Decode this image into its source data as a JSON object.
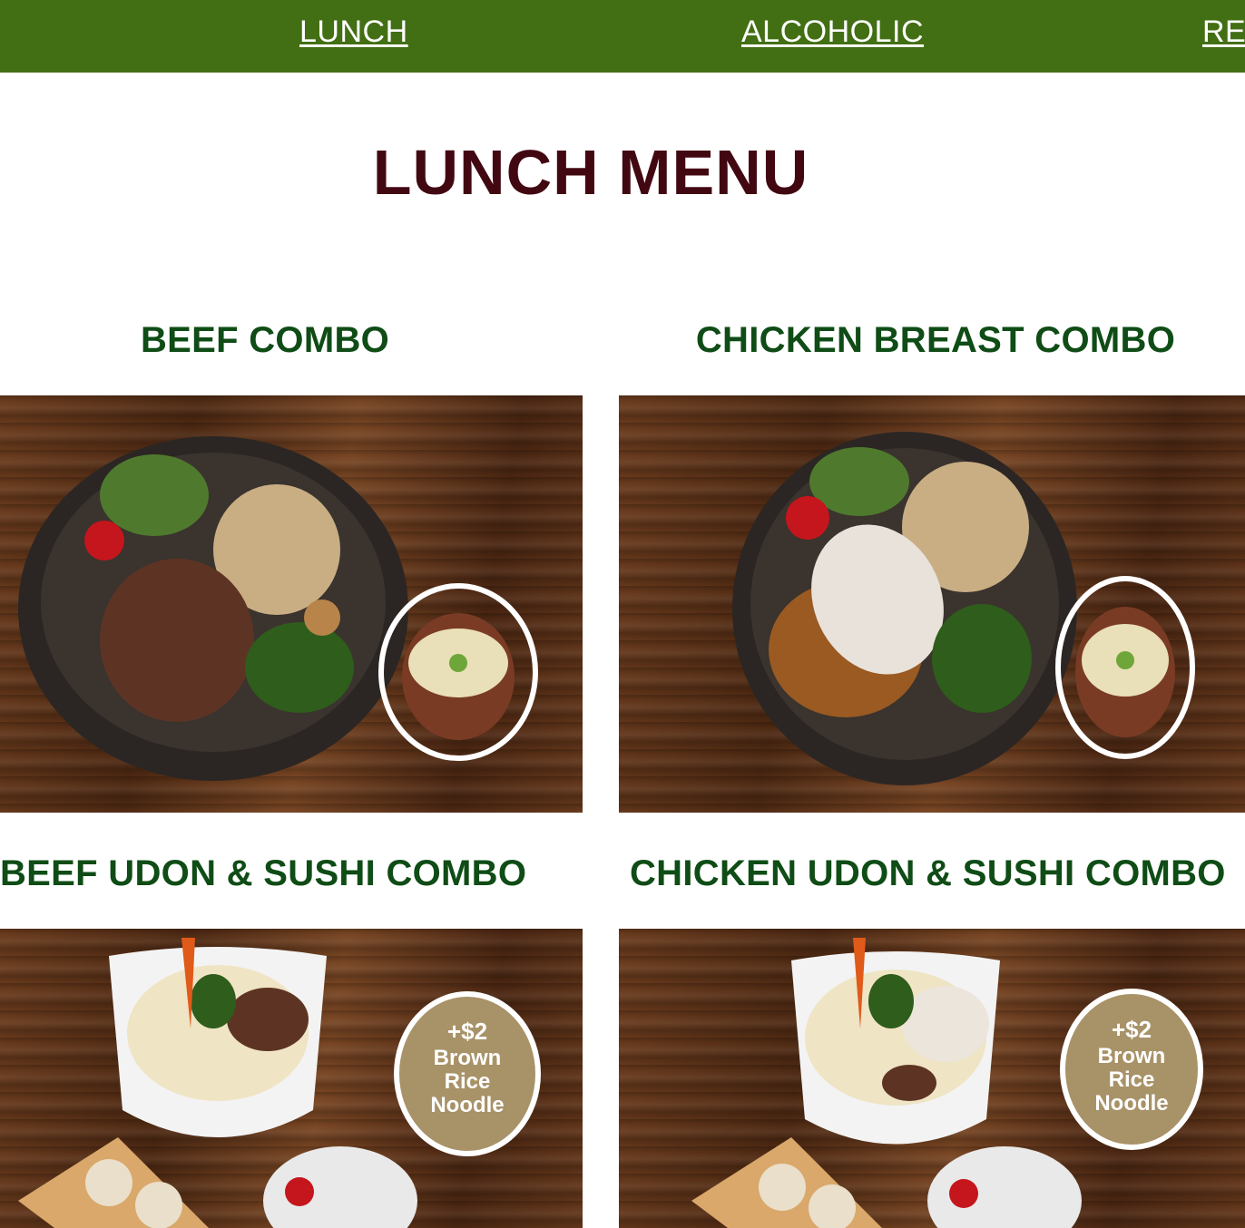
{
  "nav": {
    "lunch": "LUNCH",
    "alcoholic": "ALCOHOLIC",
    "res": "RES"
  },
  "page": {
    "title": "LUNCH MENU"
  },
  "items": [
    {
      "title": "BEEF COMBO"
    },
    {
      "title": "CHICKEN BREAST COMBO"
    },
    {
      "title": "BEEF UDON & SUSHI COMBO",
      "badge": {
        "price": "+$2",
        "line1": "Brown",
        "line2": "Rice",
        "line3": "Noodle"
      }
    },
    {
      "title": "CHICKEN UDON & SUSHI COMBO",
      "badge": {
        "price": "+$2",
        "line1": "Brown",
        "line2": "Rice",
        "line3": "Noodle"
      }
    }
  ],
  "colors": {
    "nav_bg": "#436f14",
    "title": "#420812",
    "item_title": "#0f4c16"
  }
}
